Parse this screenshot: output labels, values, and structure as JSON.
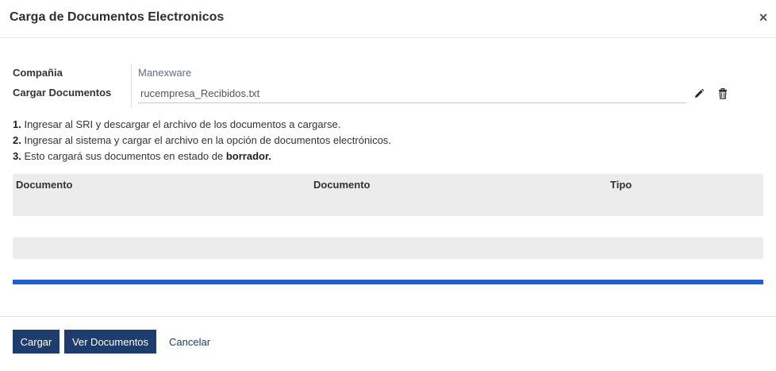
{
  "dialog": {
    "title": "Carga de Documentos Electronicos",
    "close_label": "×"
  },
  "form": {
    "company_label": "Compañia",
    "company_value": "Manexware",
    "upload_label": "Cargar Documentos",
    "upload_value": "rucempresa_Recibidos.txt",
    "edit_icon": "pencil-icon",
    "delete_icon": "trash-icon"
  },
  "instructions": [
    {
      "num": "1.",
      "text": " Ingresar al SRI y descargar el archivo de los documentos a cargarse."
    },
    {
      "num": "2.",
      "text": " Ingresar al sistema y cargar el archivo en la opción de documentos electrónicos."
    },
    {
      "num": "3.",
      "text": " Esto cargará sus documentos en estado de ",
      "bold": "borrador."
    }
  ],
  "table": {
    "columns": [
      "Documento",
      "Documento",
      "Tipo"
    ],
    "rows": 3
  },
  "progress": {
    "percent": 100,
    "color": "#1f5fcf"
  },
  "footer": {
    "cargar_label": "Cargar",
    "ver_label": "Ver Documentos",
    "cancel_label": "Cancelar"
  }
}
